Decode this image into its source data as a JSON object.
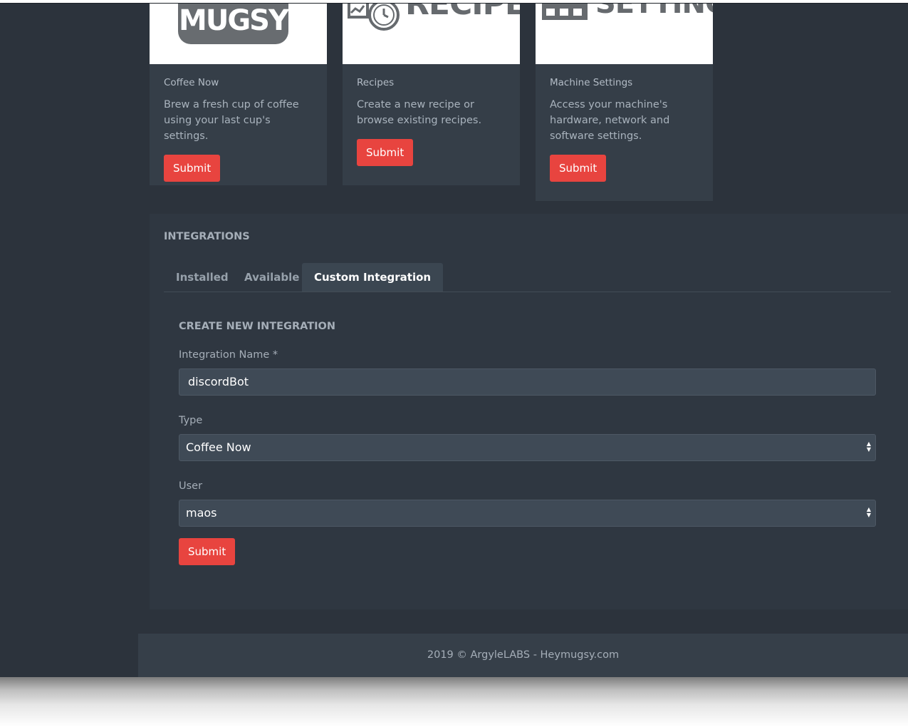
{
  "cards": [
    {
      "logo_text": "MUGSY",
      "title": "Coffee Now",
      "text": "Brew a fresh cup of coffee using your last cup's settings.",
      "button": "Submit"
    },
    {
      "logo_text": "RECIPES",
      "title": "Recipes",
      "text": "Create a new recipe or browse existing recipes.",
      "button": "Submit"
    },
    {
      "logo_text": "SETTINGS",
      "title": "Machine Settings",
      "text": "Access your machine's hardware, network and software settings.",
      "button": "Submit"
    }
  ],
  "integrations": {
    "title": "INTEGRATIONS",
    "tabs": [
      {
        "label": "Installed",
        "active": false
      },
      {
        "label": "Available",
        "active": false
      },
      {
        "label": "Custom Integration",
        "active": true
      }
    ],
    "form": {
      "title": "CREATE NEW INTEGRATION",
      "name_label": "Integration Name *",
      "name_value": "discordBot",
      "type_label": "Type",
      "type_value": "Coffee Now",
      "user_label": "User",
      "user_value": "maos",
      "submit": "Submit"
    }
  },
  "footer": {
    "text": "2019 © ArgyleLABS - Heymugsy.com"
  },
  "colors": {
    "accent": "#e8443f",
    "background": "#2c333c",
    "card": "#353e48"
  }
}
